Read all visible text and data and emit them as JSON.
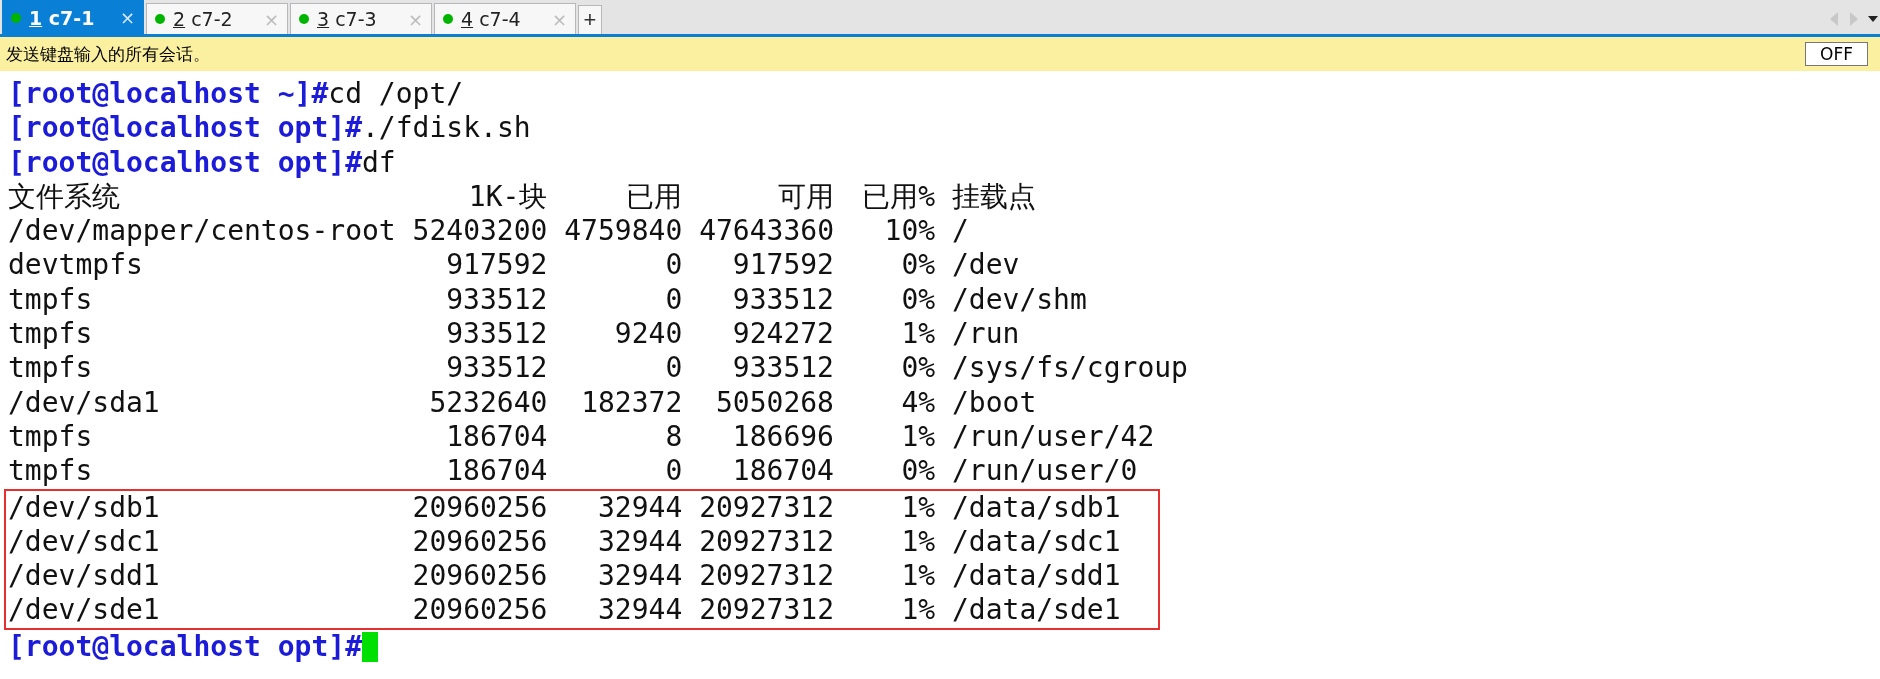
{
  "tabs": [
    {
      "number": "1",
      "title": "c7-1",
      "selected": true,
      "color": "#00b400",
      "close": "×"
    },
    {
      "number": "2",
      "title": "c7-2",
      "selected": false,
      "color": "#00b400",
      "close": "×"
    },
    {
      "number": "3",
      "title": "c7-3",
      "selected": false,
      "color": "#00b400",
      "close": "×"
    },
    {
      "number": "4",
      "title": "c7-4",
      "selected": false,
      "color": "#00b400",
      "close": "×"
    }
  ],
  "new_tab": "+",
  "broadcast_bar": {
    "message": "发送键盘输入的所有会话。",
    "toggle": "OFF"
  },
  "terminal": {
    "commands": [
      {
        "prompt": "[root@localhost ~]#",
        "command": "cd /opt/"
      },
      {
        "prompt": "[root@localhost opt]#",
        "command": "./fdisk.sh"
      },
      {
        "prompt": "[root@localhost opt]#",
        "command": "df"
      }
    ],
    "table": {
      "columns": [
        "文件系统",
        "1K-块",
        "已用",
        "可用",
        "已用%",
        "挂载点"
      ],
      "rows": [
        {
          "cells": [
            "/dev/mapper/centos-root",
            "52403200",
            "4759840",
            "47643360",
            "10%",
            "/"
          ],
          "marked": false
        },
        {
          "cells": [
            "devtmpfs",
            "917592",
            "0",
            "917592",
            "0%",
            "/dev"
          ],
          "marked": false
        },
        {
          "cells": [
            "tmpfs",
            "933512",
            "0",
            "933512",
            "0%",
            "/dev/shm"
          ],
          "marked": false
        },
        {
          "cells": [
            "tmpfs",
            "933512",
            "9240",
            "924272",
            "1%",
            "/run"
          ],
          "marked": false
        },
        {
          "cells": [
            "tmpfs",
            "933512",
            "0",
            "933512",
            "0%",
            "/sys/fs/cgroup"
          ],
          "marked": false
        },
        {
          "cells": [
            "/dev/sda1",
            "5232640",
            "182372",
            "5050268",
            "4%",
            "/boot"
          ],
          "marked": false
        },
        {
          "cells": [
            "tmpfs",
            "186704",
            "8",
            "186696",
            "1%",
            "/run/user/42"
          ],
          "marked": false
        },
        {
          "cells": [
            "tmpfs",
            "186704",
            "0",
            "186704",
            "0%",
            "/run/user/0"
          ],
          "marked": false
        },
        {
          "cells": [
            "/dev/sdb1",
            "20960256",
            "32944",
            "20927312",
            "1%",
            "/data/sdb1"
          ],
          "marked": true
        },
        {
          "cells": [
            "/dev/sdc1",
            "20960256",
            "32944",
            "20927312",
            "1%",
            "/data/sdc1"
          ],
          "marked": true
        },
        {
          "cells": [
            "/dev/sdd1",
            "20960256",
            "32944",
            "20927312",
            "1%",
            "/data/sdd1"
          ],
          "marked": true
        },
        {
          "cells": [
            "/dev/sde1",
            "20960256",
            "32944",
            "20927312",
            "1%",
            "/data/sde1"
          ],
          "marked": true
        }
      ]
    },
    "final_prompt": "[root@localhost opt]#"
  }
}
